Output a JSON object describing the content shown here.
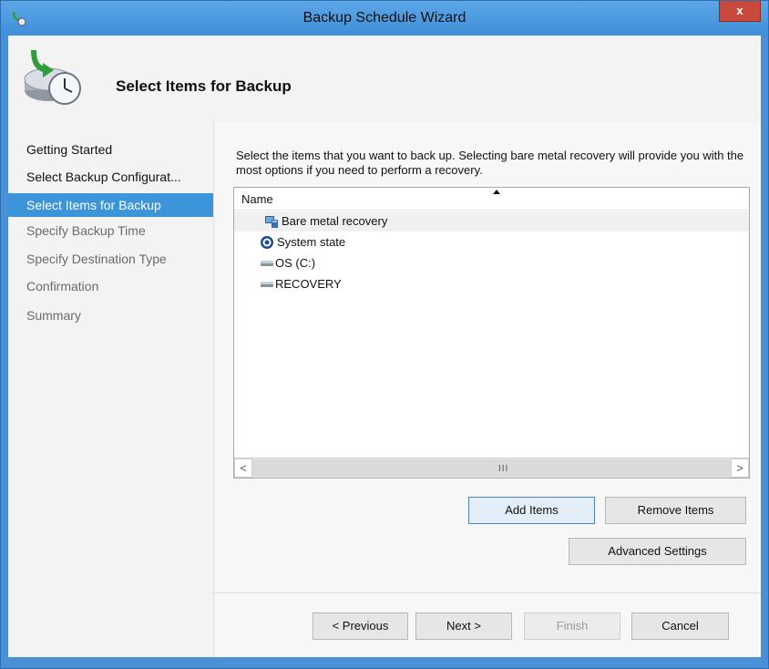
{
  "window": {
    "title": "Backup Schedule Wizard",
    "close_label": "x",
    "accent_color": "#3d95d9"
  },
  "header": {
    "title": "Select Items for Backup",
    "icon": "backup-schedule-icon"
  },
  "nav": {
    "items": [
      {
        "label": "Getting Started",
        "state": "done"
      },
      {
        "label": "Select Backup Configurat...",
        "state": "done"
      },
      {
        "label": "Select Items for Backup",
        "state": "active"
      },
      {
        "label": "Specify Backup Time",
        "state": "pending"
      },
      {
        "label": "Specify Destination Type",
        "state": "pending"
      },
      {
        "label": "Confirmation",
        "state": "pending"
      },
      {
        "label": "Summary",
        "state": "pending"
      }
    ]
  },
  "content": {
    "description": "Select the items that you want to back up. Selecting bare metal recovery will provide you with the most options if you need to perform a recovery.",
    "list": {
      "column_header": "Name",
      "items": [
        {
          "label": "Bare metal recovery",
          "icon": "bare-metal-recovery-icon"
        },
        {
          "label": "System state",
          "icon": "system-state-icon"
        },
        {
          "label": "OS (C:)",
          "icon": "drive-icon"
        },
        {
          "label": "RECOVERY",
          "icon": "drive-icon"
        }
      ],
      "scroll_grip": "III",
      "scroll_left": "<",
      "scroll_right": ">"
    },
    "buttons": {
      "add_items": "Add Items",
      "remove_items": "Remove Items",
      "advanced_settings": "Advanced Settings"
    }
  },
  "footer": {
    "previous": "< Previous",
    "next": "Next >",
    "finish": "Finish",
    "cancel": "Cancel"
  }
}
